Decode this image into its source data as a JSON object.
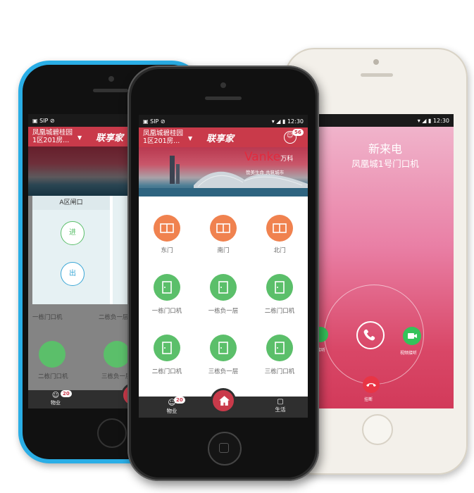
{
  "status": {
    "carrier": "SIP",
    "time": "12:30"
  },
  "app": {
    "location_line1": "凤凰城碧桂园",
    "location_line2": "1区201房...",
    "logo": "联享家",
    "notification_count": "56",
    "brand": "Vanke",
    "brand_cn": "万科",
    "slogan": "赞美生命  共筑城市"
  },
  "gates": [
    {
      "label": "东门",
      "icon": "gate-icon"
    },
    {
      "label": "南门",
      "icon": "gate-icon"
    },
    {
      "label": "北门",
      "icon": "gate-icon"
    }
  ],
  "doors_row1": [
    {
      "label": "一栋门口机",
      "icon": "door-icon"
    },
    {
      "label": "一栋负一层",
      "icon": "door-icon"
    },
    {
      "label": "二栋门口机",
      "icon": "door-icon"
    }
  ],
  "doors_row2": [
    {
      "label": "二栋门口机",
      "icon": "door-icon"
    },
    {
      "label": "三栋负一层",
      "icon": "door-icon"
    },
    {
      "label": "三栋门口机",
      "icon": "door-icon"
    }
  ],
  "nav": {
    "property_label": "物业",
    "property_badge": "20",
    "life_label": "生活"
  },
  "left_phone": {
    "dialog_title": "A区闸口",
    "enter_label": "进",
    "exit_label": "出",
    "row1": [
      "一栋门口机",
      "二栋负一层"
    ],
    "row2": [
      "二栋门口机",
      "三栋负一层"
    ],
    "nav_label": "物业",
    "nav_badge": "20"
  },
  "call": {
    "title": "新来电",
    "caller": "凤凰城1号门口机",
    "audio_label": "接听",
    "video_label": "视频接听",
    "hangup_label": "挂断"
  },
  "colors": {
    "brand_red": "#c93a4a",
    "accent_orange": "#f0824f",
    "accent_green": "#5bbf6a",
    "left_phone_body": "#2aaee6",
    "right_phone_body": "#f2efe9"
  }
}
